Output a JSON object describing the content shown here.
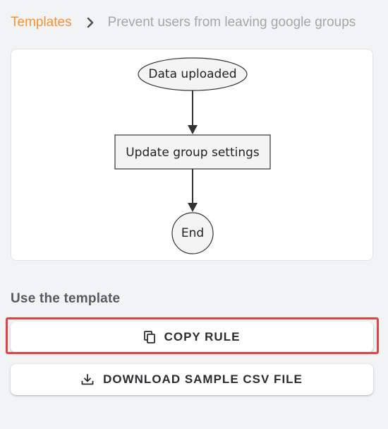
{
  "breadcrumb": {
    "link_label": "Templates",
    "separator_icon": "chevron-right-icon",
    "current_label": "Prevent users from leaving google groups"
  },
  "flowchart": {
    "nodes": [
      {
        "id": "start",
        "label": "Data uploaded",
        "shape": "ellipse"
      },
      {
        "id": "step",
        "label": "Update group settings",
        "shape": "rectangle"
      },
      {
        "id": "end",
        "label": "End",
        "shape": "circle"
      }
    ],
    "edges": [
      {
        "from": "start",
        "to": "step"
      },
      {
        "from": "step",
        "to": "end"
      }
    ]
  },
  "section": {
    "title": "Use the template"
  },
  "actions": {
    "copy_label": "COPY RULE",
    "copy_icon": "copy-icon",
    "download_label": "DOWNLOAD SAMPLE CSV FILE",
    "download_icon": "download-icon"
  },
  "colors": {
    "accent": "#f5922f",
    "muted_text": "#a3a6ab",
    "highlight": "#dd4545",
    "background": "#f2f3f5"
  }
}
